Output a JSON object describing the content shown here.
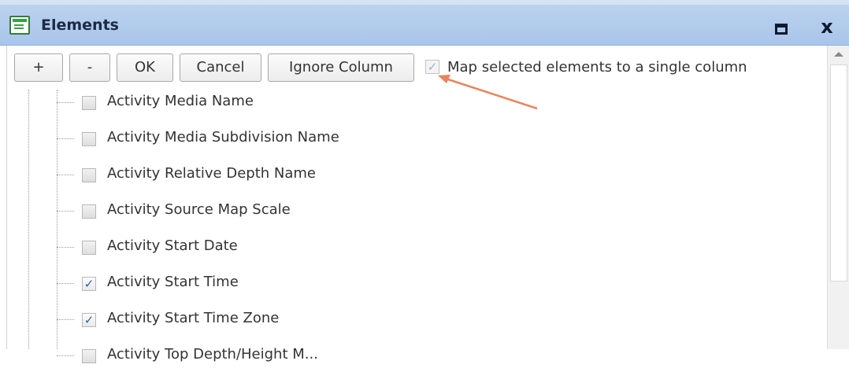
{
  "window": {
    "title": "Elements",
    "icon": "form-window-icon",
    "maximize_icon": "maximize-icon",
    "close_label": "x"
  },
  "toolbar": {
    "add_label": "+",
    "remove_label": "-",
    "ok_label": "OK",
    "cancel_label": "Cancel",
    "ignore_label": "Ignore Column",
    "map_checkbox_checked": true,
    "map_label": "Map selected elements to a single column"
  },
  "items": [
    {
      "label": "Activity Media Name",
      "checked": false
    },
    {
      "label": "Activity Media Subdivision Name",
      "checked": false
    },
    {
      "label": "Activity Relative Depth Name",
      "checked": false
    },
    {
      "label": "Activity Source Map Scale",
      "checked": false
    },
    {
      "label": "Activity Start Date",
      "checked": false
    },
    {
      "label": "Activity Start Time",
      "checked": true
    },
    {
      "label": "Activity Start Time Zone",
      "checked": true
    },
    {
      "label": "Activity Top Depth/Height M...",
      "checked": false
    }
  ],
  "annotation": {
    "color": "#e8845c"
  }
}
